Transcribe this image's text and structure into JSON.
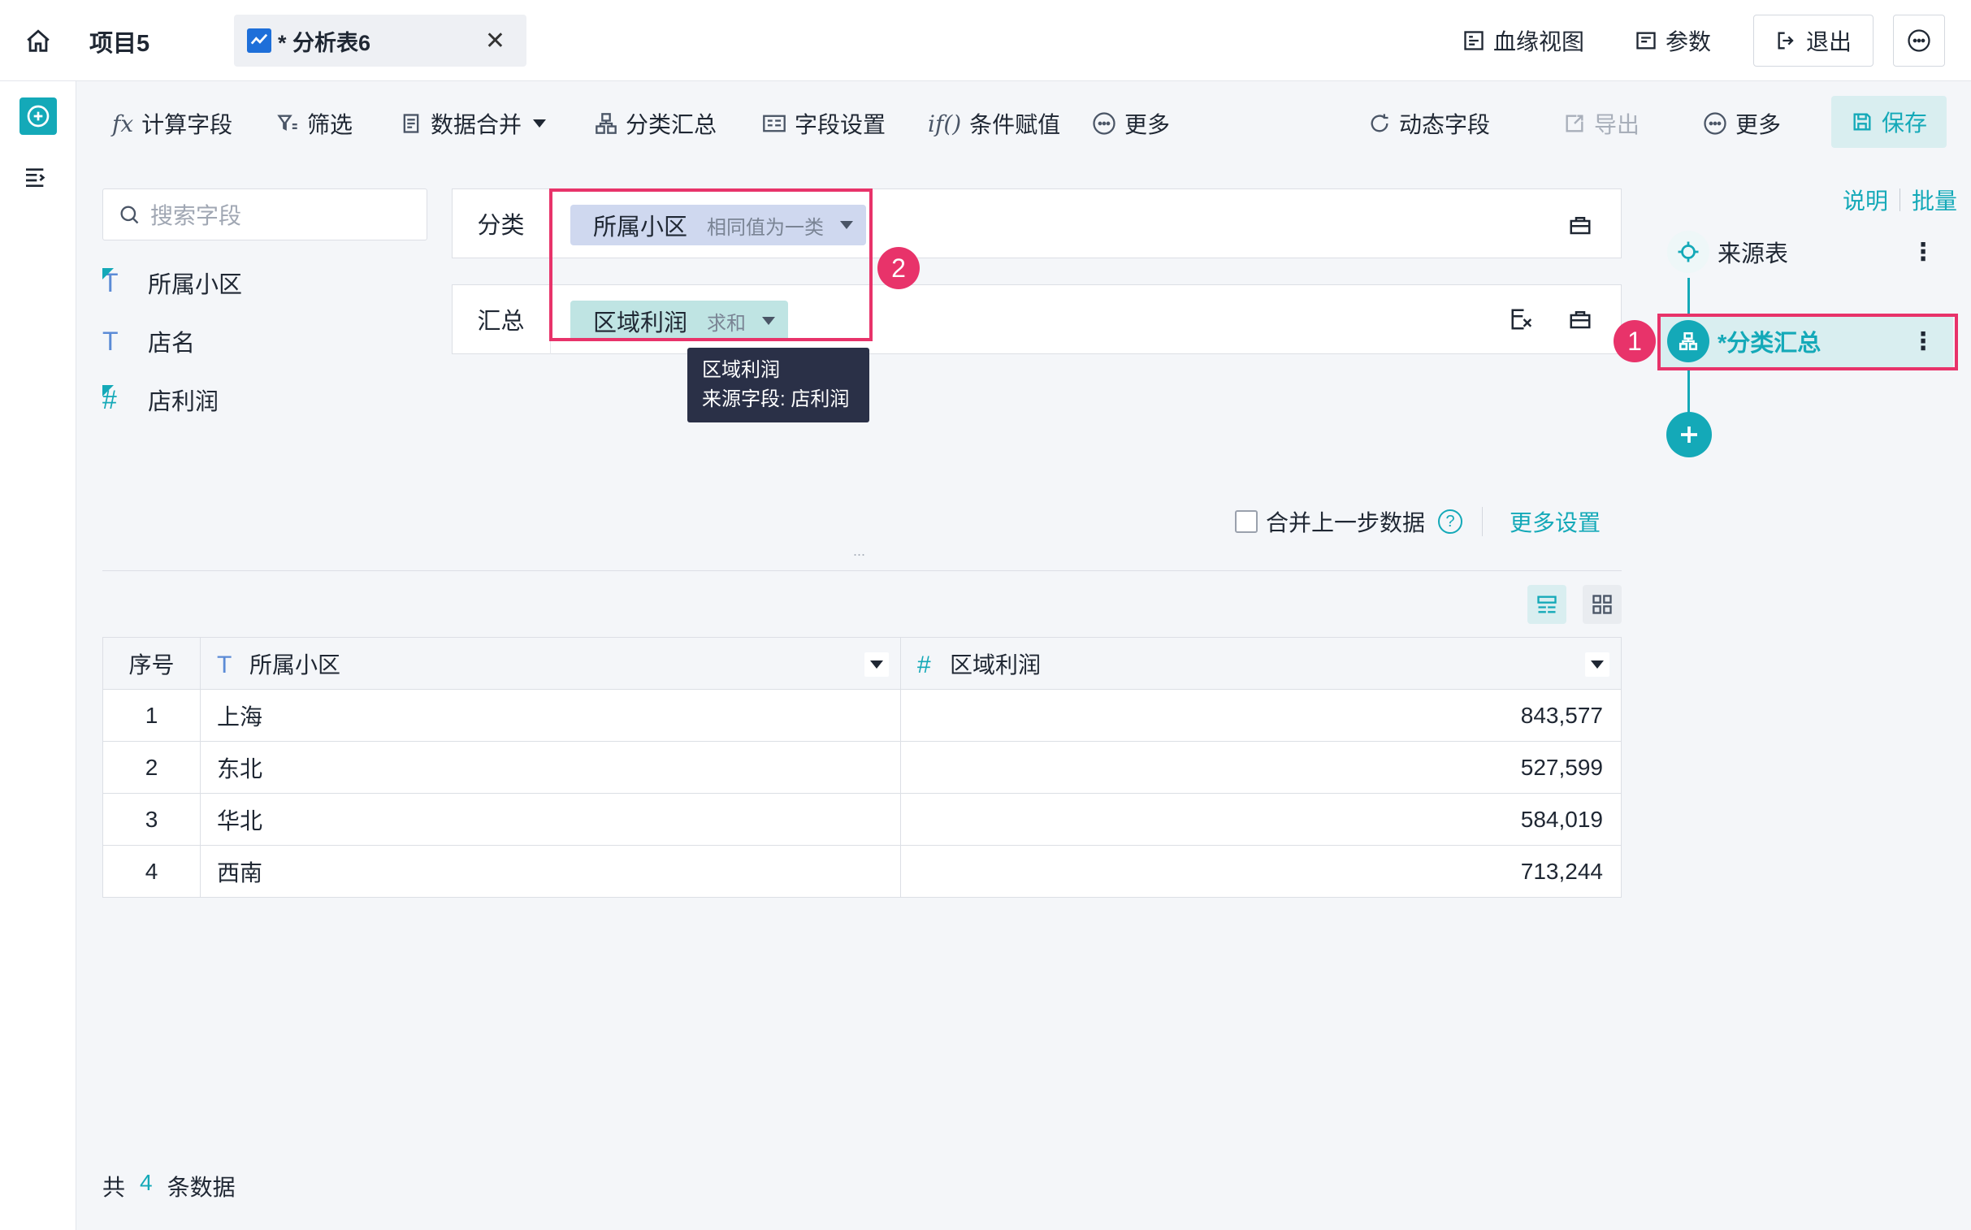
{
  "topbar": {
    "project": "项目5",
    "tab_title": "* 分析表6",
    "lineage": "血缘视图",
    "params": "参数",
    "exit": "退出"
  },
  "toolbar": {
    "calc_field": "计算字段",
    "filter": "筛选",
    "merge": "数据合并",
    "group_summary": "分类汇总",
    "field_settings": "字段设置",
    "conditional": "条件赋值",
    "more_left": "更多",
    "dynamic_field": "动态字段",
    "export": "导出",
    "more_right": "更多",
    "save": "保存"
  },
  "fields": {
    "search_placeholder": "搜索字段",
    "items": [
      {
        "name": "所属小区",
        "type": "text",
        "icon": "text-type-icon"
      },
      {
        "name": "店名",
        "type": "text",
        "icon": "text-type-icon"
      },
      {
        "name": "店利润",
        "type": "number",
        "icon": "number-type-icon"
      }
    ]
  },
  "config": {
    "group_label": "分类",
    "group_chip": "所属小区",
    "group_chip_sub": "相同值为一类",
    "summary_label": "汇总",
    "summary_chip": "区域利润",
    "summary_chip_sub": "求和",
    "tooltip_title": "区域利润",
    "tooltip_source": "来源字段: 店利润",
    "badge_2": "2",
    "merge_prev": "合并上一步数据",
    "more_settings": "更多设置",
    "dots": "..."
  },
  "table": {
    "headers": [
      "序号",
      "所属小区",
      "区域利润"
    ],
    "rows": [
      {
        "idx": "1",
        "region": "上海",
        "profit": "843,577"
      },
      {
        "idx": "2",
        "region": "东北",
        "profit": "527,599"
      },
      {
        "idx": "3",
        "region": "华北",
        "profit": "584,019"
      },
      {
        "idx": "4",
        "region": "西南",
        "profit": "713,244"
      }
    ],
    "total_prefix": "共",
    "total_count": "4",
    "total_suffix": "条数据"
  },
  "steps": {
    "explain": "说明",
    "batch": "批量",
    "source": "来源表",
    "current": "*分类汇总",
    "badge_1": "1"
  },
  "colors": {
    "accent": "#14a9b8",
    "highlight": "#e8336a",
    "chip_blue": "#cfd8ef",
    "chip_teal": "#bfe4e3"
  }
}
